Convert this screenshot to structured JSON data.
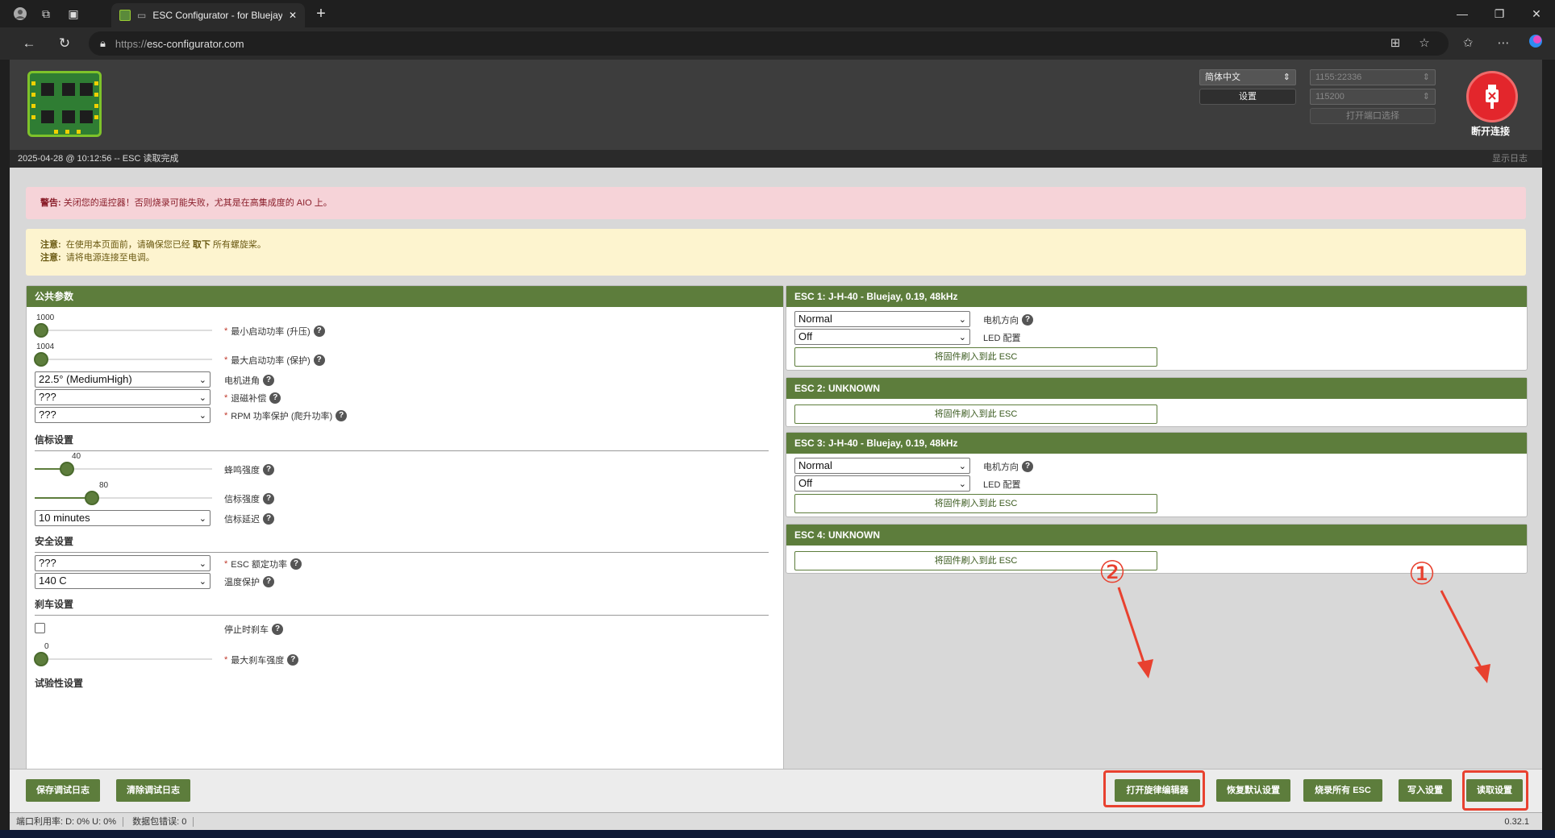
{
  "browser": {
    "tab_title": "ESC Configurator - for Bluejay",
    "url_scheme": "https://",
    "url_host": "esc-configurator.com",
    "win_min": "—",
    "win_restore": "❐",
    "win_close": "✕"
  },
  "header": {
    "language": "简体中文",
    "settings_button": "设置",
    "port": "1155:22336",
    "baud": "115200",
    "open_port_button": "打开端口选择",
    "disconnect_label": "断开连接"
  },
  "log": {
    "message": "2025-04-28 @ 10:12:56 -- ESC 读取完成",
    "show_log": "显示日志"
  },
  "warning": {
    "prefix": "警告:",
    "text": " 关闭您的遥控器！否则烧录可能失败，尤其是在高集成度的 AIO 上。"
  },
  "notes": {
    "line1_prefix": "注意:",
    "line1_a": "在使用本页面前，请确保您已经",
    "line1_bold": "取下",
    "line1_b": "所有螺旋桨。",
    "line2_prefix": "注意:",
    "line2_text": "请将电源连接至电调。"
  },
  "common": {
    "title": "公共参数",
    "min_startup_value": "1000",
    "min_startup_fraction": 0.0,
    "min_startup_label": "最小启动功率 (升压)",
    "max_startup_value": "1004",
    "max_startup_fraction": 0.0,
    "max_startup_label": "最大启动功率 (保护)",
    "timing_value": "22.5° (MediumHigh)",
    "timing_label": "电机进角",
    "demag_value": "???",
    "demag_label": "退磁补偿",
    "rpm_value": "???",
    "rpm_label": "RPM 功率保护 (爬升功率)",
    "beacon_section": "信标设置",
    "beep_value": "40",
    "beep_fraction": 0.16,
    "beep_label": "蜂鸣强度",
    "beacon_value": "80",
    "beacon_fraction": 0.31,
    "beacon_label": "信标强度",
    "beacon_delay_value": "10 minutes",
    "beacon_delay_label": "信标延迟",
    "safety_section": "安全设置",
    "power_rating_value": "???",
    "power_rating_label": "ESC 额定功率",
    "temp_value": "140 C",
    "temp_label": "温度保护",
    "brake_section": "刹车设置",
    "brake_stop_label": "停止时刹车",
    "brake_strength_value": "0",
    "brake_strength_fraction": 0.0,
    "brake_strength_label": "最大刹车强度",
    "experimental_section": "试验性设置"
  },
  "escs": [
    {
      "title": "ESC 1: J-H-40 - Bluejay, 0.19, 48kHz",
      "direction": "Normal",
      "led": "Off",
      "direction_label": "电机方向",
      "led_label": "LED 配置",
      "flash": "将固件刷入到此 ESC"
    },
    {
      "title": "ESC 2: UNKNOWN",
      "flash": "将固件刷入到此 ESC"
    },
    {
      "title": "ESC 3: J-H-40 - Bluejay, 0.19, 48kHz",
      "direction": "Normal",
      "led": "Off",
      "direction_label": "电机方向",
      "led_label": "LED 配置",
      "flash": "将固件刷入到此 ESC"
    },
    {
      "title": "ESC 4: UNKNOWN",
      "flash": "将固件刷入到此 ESC"
    }
  ],
  "footer": {
    "save_log": "保存调试日志",
    "clear_log": "清除调试日志",
    "melody_editor": "打开旋律编辑器",
    "restore_defaults": "恢复默认设置",
    "flash_all": "烧录所有 ESC",
    "write_settings": "写入设置",
    "read_settings": "读取设置"
  },
  "status": {
    "port_util": "端口利用率:  D: 0% U: 0%",
    "packet_errors": "数据包错误: 0",
    "version": "0.32.1"
  },
  "annotations": {
    "circle1": "①",
    "circle2": "②",
    "color": "#e8412f"
  },
  "colors": {
    "accent": "#5d7d3c",
    "warning_bg": "#f6d3d8",
    "note_bg": "#fdf4cf",
    "disconnect": "#e3262c"
  }
}
